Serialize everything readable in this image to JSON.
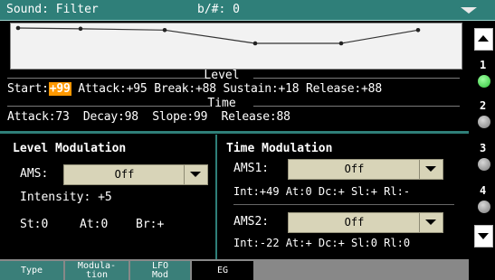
{
  "header": {
    "title": "Sound: Filter",
    "key_label": "b/#: 0"
  },
  "level": {
    "section_label": "Level",
    "start_label": "Start:",
    "start_value": "+99",
    "attack": "Attack:+95",
    "break": "Break:+88",
    "sustain": "Sustain:+18",
    "release": "Release:+88"
  },
  "time": {
    "section_label": "Time",
    "attack": "Attack:73",
    "decay": "Decay:98",
    "slope": "Slope:99",
    "release": "Release:88"
  },
  "level_modulation": {
    "title": "Level Modulation",
    "ams_label": "AMS:",
    "ams_value": "Off",
    "intensity": "Intensity: +5",
    "st": "St:0",
    "at": "At:0",
    "br": "Br:+"
  },
  "time_modulation": {
    "title": "Time Modulation",
    "ams1_label": "AMS1:",
    "ams1_value": "Off",
    "ams1_info": "Int:+49  At:0  Dc:+  Sl:+  Rl:-",
    "ams2_label": "AMS2:",
    "ams2_value": "Off",
    "ams2_info": "Int:-22  At:+  Dc:+  Sl:0  Rl:0"
  },
  "tabs": [
    {
      "label": "Type"
    },
    {
      "label": "Modula-\ntion"
    },
    {
      "label": "LFO\nMod"
    },
    {
      "label": "EG"
    }
  ],
  "sidebar": {
    "numbers": [
      "1",
      "2",
      "3",
      "4"
    ],
    "active_index": 0
  },
  "envelope": {
    "levels": [
      99,
      95,
      88,
      18,
      18,
      88
    ],
    "range": [
      -99,
      99
    ]
  },
  "colors": {
    "accent": "#2f7f79",
    "highlight": "#ff9800",
    "active_led": "#2fc23a"
  }
}
